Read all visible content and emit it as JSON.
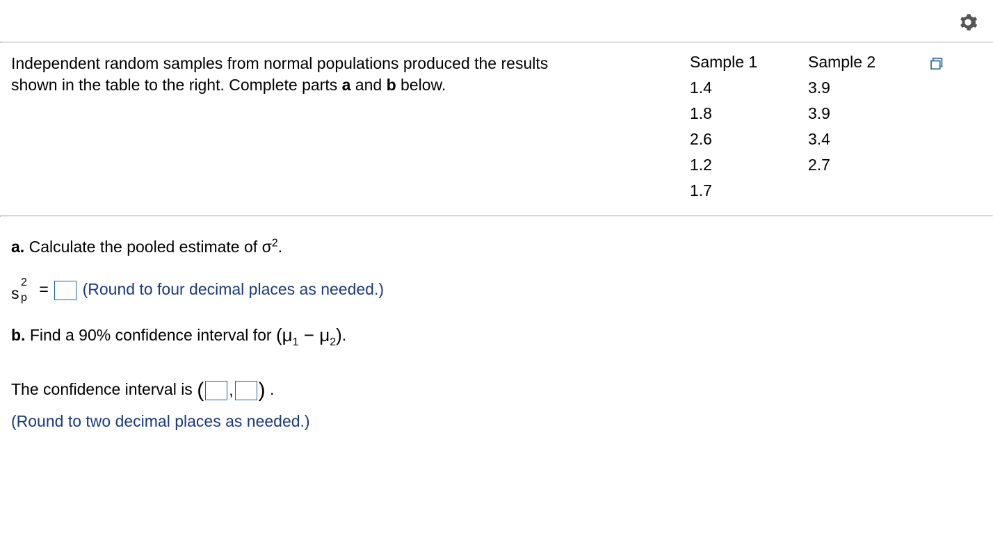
{
  "problem_text_line1": "Independent random samples from normal populations produced the results",
  "problem_text_line2": "shown in the table to the right. Complete parts ",
  "bold_a": "a",
  "and_text": " and ",
  "bold_b": "b",
  "below_text": " below.",
  "table": {
    "sample1_header": "Sample 1",
    "sample2_header": "Sample 2",
    "sample1_values": [
      "1.4",
      "1.8",
      "2.6",
      "1.2",
      "1.7"
    ],
    "sample2_values": [
      "3.9",
      "3.9",
      "3.4",
      "2.7"
    ]
  },
  "part_a": {
    "label": "a.",
    "text": " Calculate the pooled estimate of ",
    "sigma": "σ",
    "sup": "2",
    "period": ".",
    "equals": " = ",
    "hint": "(Round to four decimal places as needed.)"
  },
  "part_b": {
    "label": "b.",
    "text": " Find a 90% confidence interval for ",
    "mu": "μ",
    "sub1": "1",
    "minus": " − ",
    "sub2": "2",
    "period": ".",
    "ci_text": "The confidence interval is ",
    "comma": ",",
    "ci_period": ".",
    "hint": "(Round to two decimal places as needed.)"
  }
}
